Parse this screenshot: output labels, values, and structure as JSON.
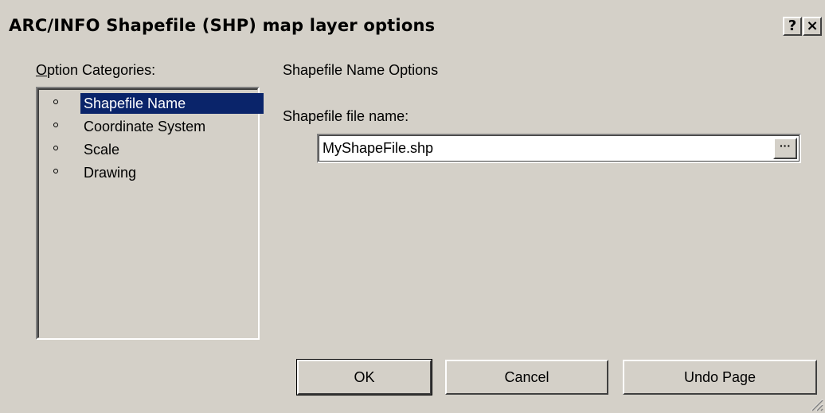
{
  "window": {
    "title": "ARC/INFO Shapefile (SHP) map layer options",
    "help_button": "?",
    "close_button": "×"
  },
  "categories": {
    "label_first": "O",
    "label_rest": "ption Categories:",
    "items": [
      {
        "label": "Shapefile Name",
        "selected": true
      },
      {
        "label": "Coordinate System",
        "selected": false
      },
      {
        "label": "Scale",
        "selected": false
      },
      {
        "label": "Drawing",
        "selected": false
      }
    ]
  },
  "panel": {
    "heading": "Shapefile Name Options",
    "file_label": "Shapefile file name:",
    "file_value": "MyShapeFile.shp",
    "browse_label": "···"
  },
  "buttons": {
    "ok": "OK",
    "cancel": "Cancel",
    "undo": "Undo Page"
  },
  "colors": {
    "dialog_bg": "#d4d0c8",
    "selection_bg": "#0a246a",
    "selection_text": "#ffffff"
  }
}
